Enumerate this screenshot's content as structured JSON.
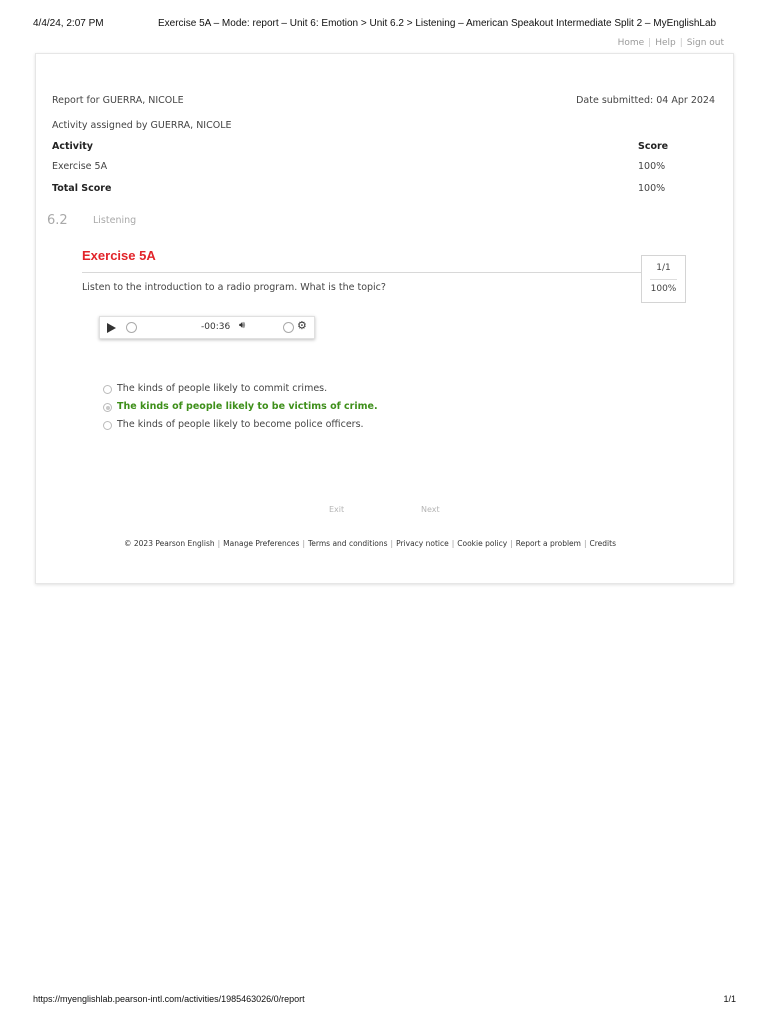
{
  "print_header": {
    "datetime": "4/4/24, 2:07 PM",
    "title": "Exercise 5A – Mode: report – Unit 6: Emotion > Unit 6.2 > Listening – American Speakout Intermediate Split 2 – MyEnglishLab"
  },
  "top_links": [
    "Home",
    "Help",
    "Sign out"
  ],
  "report": {
    "report_for": "Report for GUERRA, NICOLE",
    "date_submitted": "Date submitted: 04 Apr 2024",
    "assigned_by": "Activity assigned by GUERRA, NICOLE",
    "table": {
      "col_activity": "Activity",
      "col_score": "Score",
      "rows": [
        {
          "activity": "Exercise 5A",
          "score": "100%"
        }
      ],
      "total_label": "Total Score",
      "total_score": "100%"
    }
  },
  "section": {
    "number": "6.2",
    "title": "Listening"
  },
  "exercise": {
    "title": "Exercise 5A",
    "question": "Listen to the introduction to a radio program. What is the topic?",
    "score_fraction": "1/1",
    "score_percent": "100%",
    "player": {
      "time": "-00:36",
      "icons": [
        "play-icon",
        "progress-ring-icon",
        "volume-icon",
        "speed-ring-icon",
        "gear-icon"
      ]
    },
    "options": [
      {
        "text": "The kinds of people likely to commit crimes.",
        "selected": false,
        "correct": false
      },
      {
        "text": "The kinds of people likely to be victims of crime.",
        "selected": true,
        "correct": true
      },
      {
        "text": "The kinds of people likely to become police officers.",
        "selected": false,
        "correct": false
      }
    ],
    "correct_color": "#3e8f1a",
    "title_color": "#e2242a"
  },
  "nav": {
    "exit": "Exit",
    "next": "Next"
  },
  "footer": {
    "links": [
      "© 2023 Pearson English",
      "Manage Preferences",
      "Terms and conditions",
      "Privacy notice",
      "Cookie policy",
      "Report a problem",
      "Credits"
    ]
  },
  "print_footer": {
    "url": "https://myenglishlab.pearson-intl.com/activities/1985463026/0/report",
    "page": "1/1"
  }
}
